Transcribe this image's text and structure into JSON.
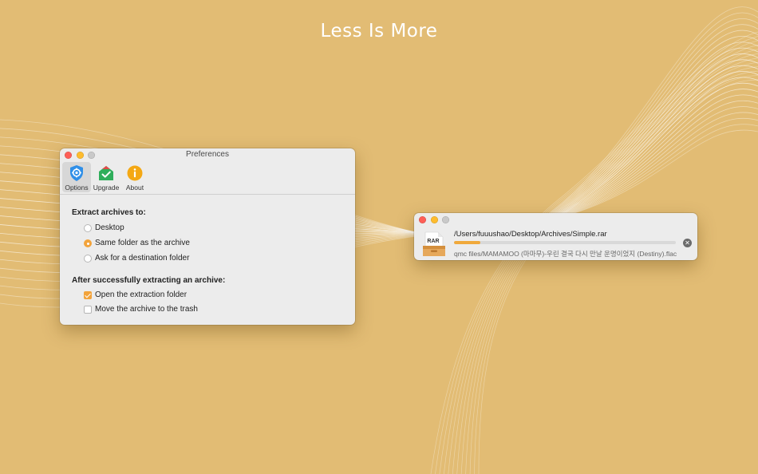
{
  "headline": "Less Is More",
  "colors": {
    "background": "#e2bc74",
    "accent": "#f2a33b",
    "progress": "#f0a93c"
  },
  "preferences": {
    "title": "Preferences",
    "toolbar": [
      {
        "label": "Options",
        "icon": "gear-shield-icon",
        "active": true
      },
      {
        "label": "Upgrade",
        "icon": "upgrade-check-icon",
        "active": false
      },
      {
        "label": "About",
        "icon": "info-icon",
        "active": false
      }
    ],
    "extract_to": {
      "heading": "Extract archives to:",
      "options": [
        {
          "label": "Desktop",
          "selected": false
        },
        {
          "label": "Same folder as the archive",
          "selected": true
        },
        {
          "label": "Ask for a destination folder",
          "selected": false
        }
      ]
    },
    "after_extract": {
      "heading": "After successfully extracting an archive:",
      "options": [
        {
          "label": "Open the extraction folder",
          "checked": true
        },
        {
          "label": "Move the archive to the trash",
          "checked": false
        }
      ]
    }
  },
  "progress_window": {
    "archive_badge": "RAR",
    "archive_path": "/Users/fuuushao/Desktop/Archives/Simple.rar",
    "progress_fraction": 0.12,
    "current_file": "qmc files/MAMAMOO (마마무)-우린 결국 다시 만날 운명이었지 (Destiny).flac",
    "stop_icon": "stop-icon"
  }
}
